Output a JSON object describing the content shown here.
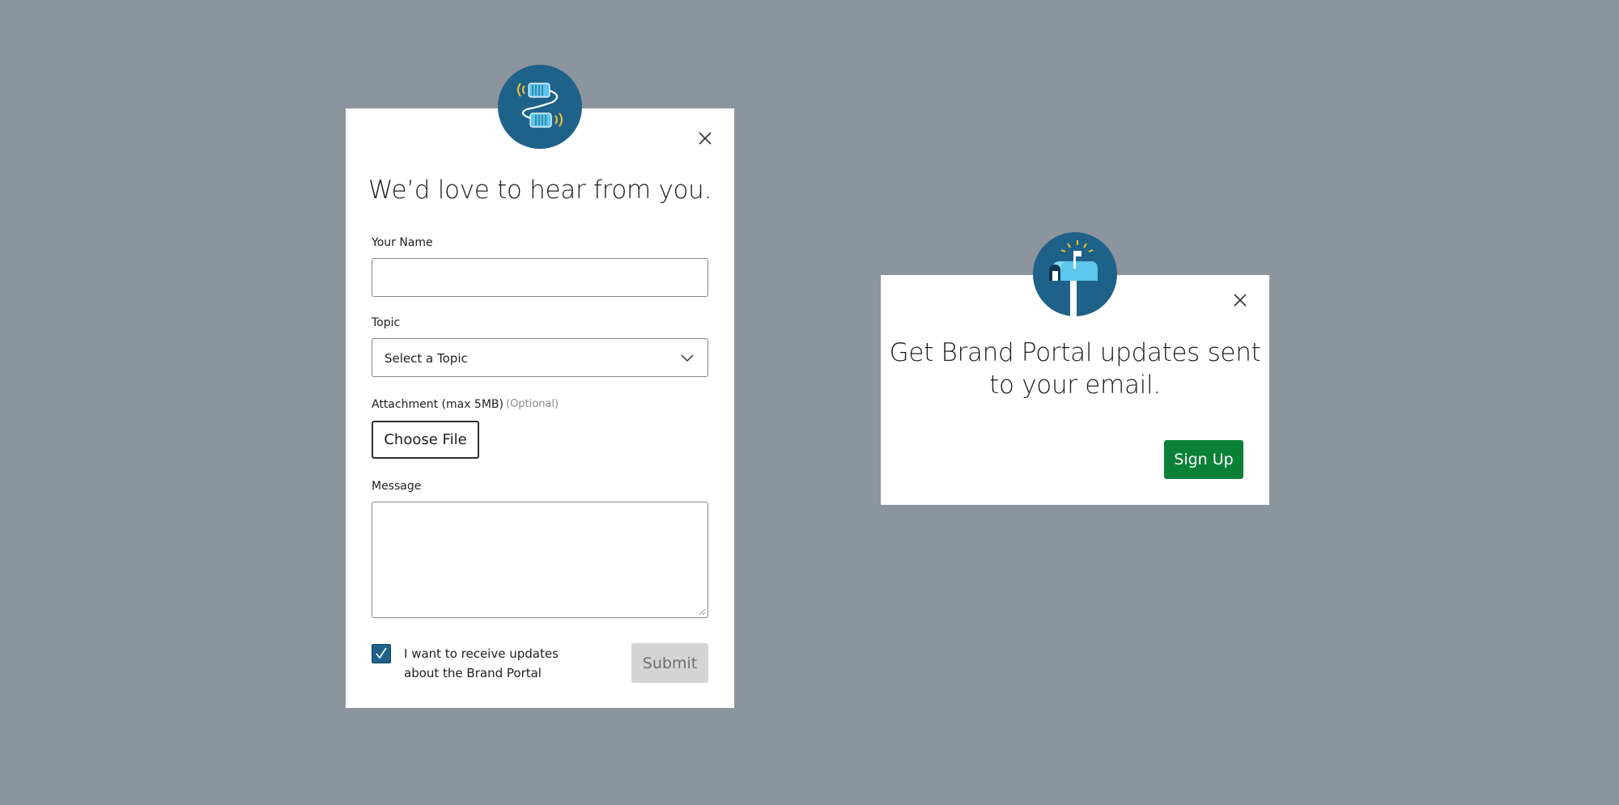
{
  "contact_modal": {
    "title": "We’d love to hear from you.",
    "badge_icon": "tin-can-phone-icon",
    "close_icon": "close-icon",
    "name_field": {
      "label": "Your Name",
      "value": ""
    },
    "topic_field": {
      "label": "Topic",
      "selected": "Select a Topic"
    },
    "attachment_field": {
      "label": "Attachment (max 5MB)",
      "optional": "(Optional)",
      "button_label": "Choose File"
    },
    "message_field": {
      "label": "Message",
      "value": ""
    },
    "updates_checkbox": {
      "label": "I want to receive updates about the Brand Portal",
      "checked": true
    },
    "submit_label": "Submit"
  },
  "promo_modal": {
    "title": "Get Brand Portal updates sent to your email.",
    "badge_icon": "mailbox-icon",
    "close_icon": "close-icon",
    "signup_label": "Sign Up"
  },
  "colors": {
    "backdrop": "#8c949d",
    "badge": "#1f6289",
    "signup_green": "#0b8137",
    "submit_disabled": "#d4d4d4",
    "checkbox_checked": "#1f6289"
  }
}
